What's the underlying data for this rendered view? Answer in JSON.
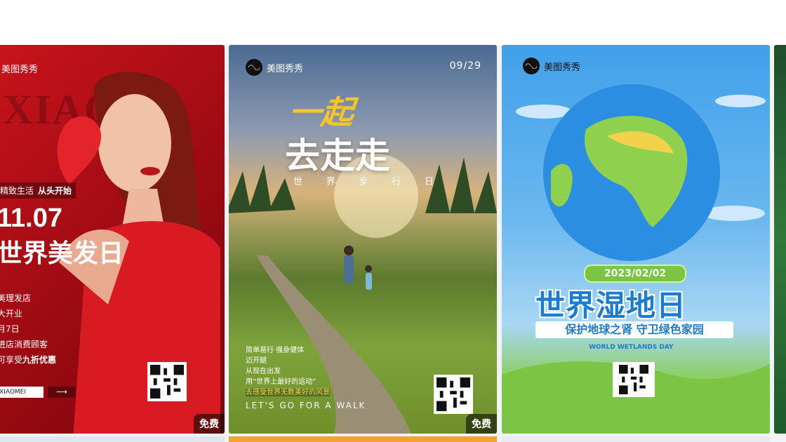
{
  "cards": [
    {
      "logo": "美图秀秀",
      "ghost_text": "XIAO",
      "slogan": "精致生活",
      "slogan_bold": "从头开始",
      "date": "11.07",
      "title": "世界美发日",
      "lines": [
        "美理发店",
        "大开业",
        "月7日",
        "进店消费顾客"
      ],
      "discount_prefix": "可享受",
      "discount_bold": "九折优惠",
      "brand_tag": "XIAOMEI",
      "arrow": "⟶",
      "badge": "免费"
    },
    {
      "logo": "美图秀秀",
      "date": "09/29",
      "title_line1": "一起",
      "title_line2": "去走走",
      "subtitle_chars": [
        "世",
        "界",
        "步",
        "行",
        "日"
      ],
      "body_lines": [
        "简单易行 强身健体",
        "迈开腿",
        "从现在出发",
        "用“世界上最好的运动”"
      ],
      "highlight_line": "去感受世界无数美好的风景",
      "english": "LET'S GO FOR  A WALK",
      "badge": "免费"
    },
    {
      "logo": "美图秀秀",
      "date": "2023/02/02",
      "title": "世界湿地日",
      "subtitle": "保护地球之肾 守卫绿色家园",
      "english": "WORLD WETLANDS DAY"
    }
  ],
  "colors": {
    "red": "#c8141c",
    "sky_blue": "#41a0ea",
    "title_blue": "#1a7bd1",
    "gold": "#f7c52a"
  }
}
